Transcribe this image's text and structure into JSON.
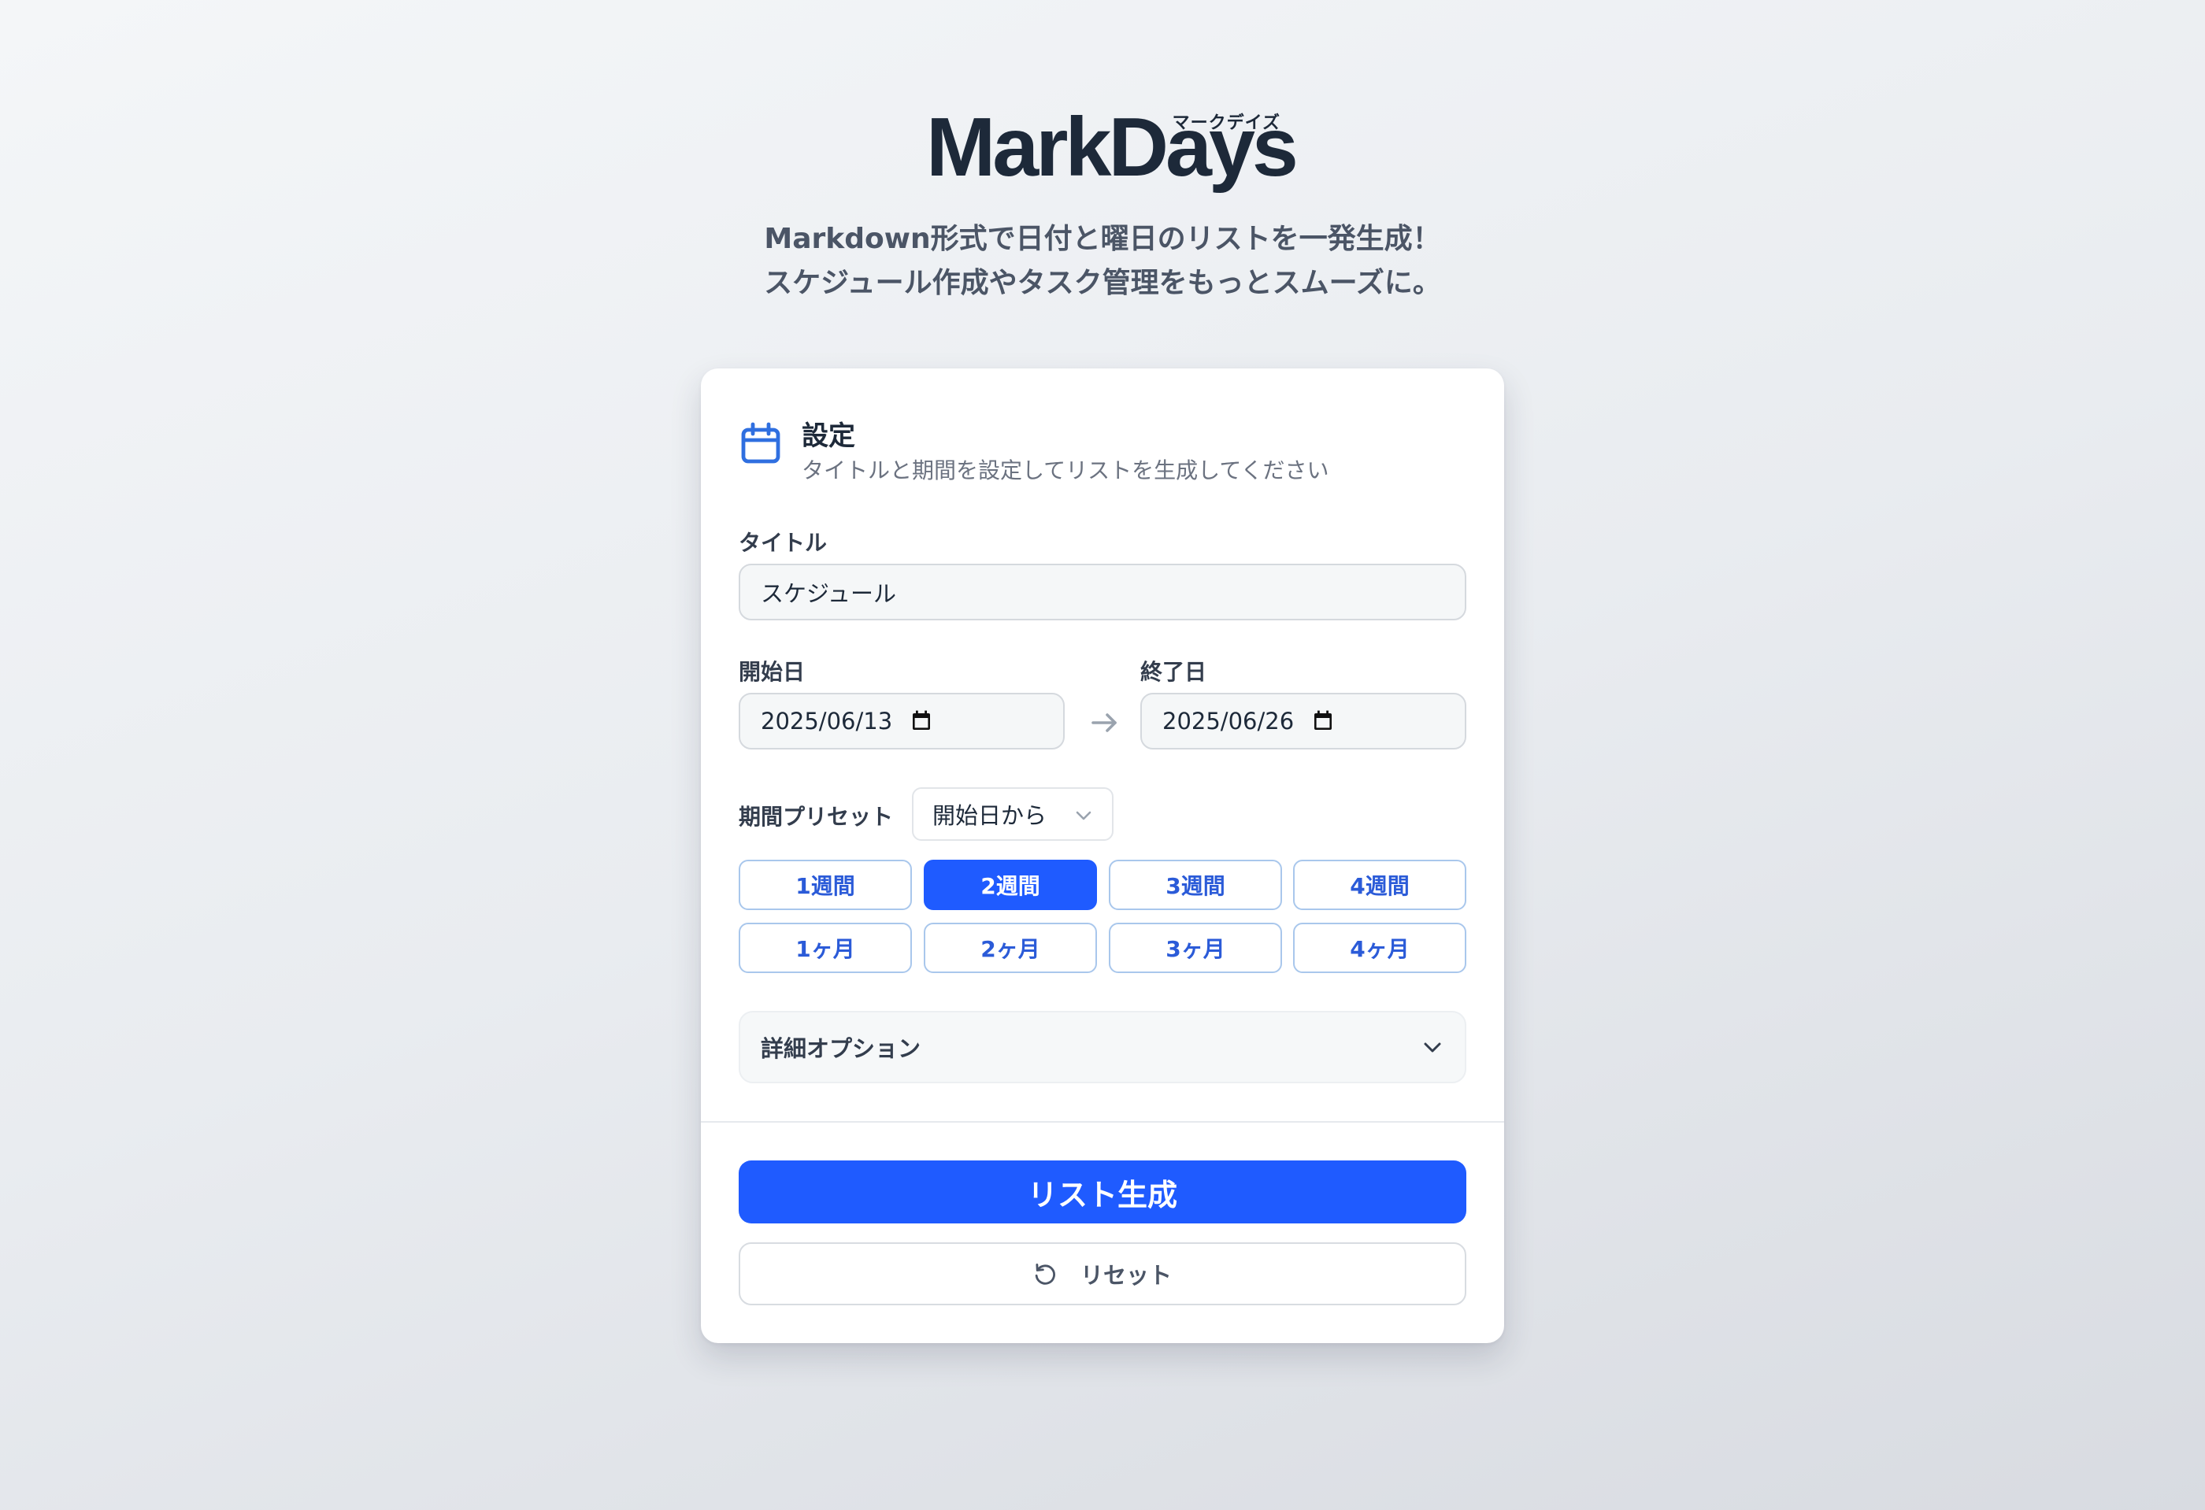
{
  "app": {
    "logo_text": "MarkDays",
    "logo_ruby": "マークデイズ",
    "tagline_line1": "Markdown形式で日付と曜日のリストを一発生成！",
    "tagline_line2": "スケジュール作成やタスク管理をもっとスムーズに。"
  },
  "settings": {
    "title": "設定",
    "subtitle": "タイトルと期間を設定してリストを生成してください",
    "icon": "calendar-icon",
    "title_field": {
      "label": "タイトル",
      "value": "スケジュール"
    },
    "start_date": {
      "label": "開始日",
      "value": "2025/06/13"
    },
    "end_date": {
      "label": "終了日",
      "value": "2025/06/26"
    },
    "preset": {
      "label": "期間プリセット",
      "selected": "開始日から",
      "options": [
        "1週間",
        "2週間",
        "3週間",
        "4週間",
        "1ヶ月",
        "2ヶ月",
        "3ヶ月",
        "4ヶ月"
      ],
      "active": "2週間"
    },
    "details_label": "詳細オプション",
    "generate_label": "リスト生成",
    "reset_label": "リセット"
  },
  "colors": {
    "accent": "#1f5bff",
    "preset_border": "#a9c7ec",
    "preset_text": "#2b5bd8",
    "heading": "#1d2939"
  }
}
